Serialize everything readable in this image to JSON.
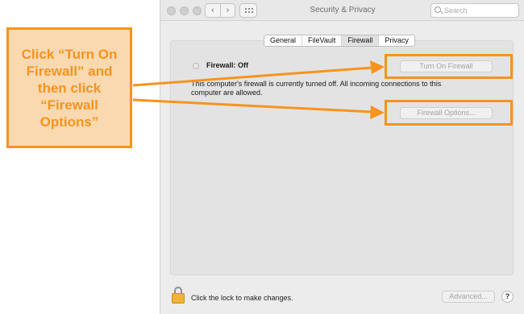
{
  "window": {
    "title": "Security & Privacy",
    "back_icon": "‹",
    "forward_icon": "›"
  },
  "search": {
    "placeholder": "Search"
  },
  "tabs": [
    {
      "label": "General",
      "selected": false
    },
    {
      "label": "FileVault",
      "selected": false
    },
    {
      "label": "Firewall",
      "selected": true
    },
    {
      "label": "Privacy",
      "selected": false
    }
  ],
  "firewall": {
    "status": "Firewall: Off",
    "description": "This computer's firewall is currently turned off. All incoming connections to this computer are allowed.",
    "turn_on_label": "Turn On Firewall",
    "options_label": "Firewall Options..."
  },
  "footer": {
    "lock_text": "Click the lock to make changes.",
    "advanced_label": "Advanced...",
    "help_label": "?"
  },
  "annotation": {
    "text": "Click “Turn On\nFirewall” and\nthen click\n“Firewall\nOptions”",
    "accent_color": "#f7931e",
    "fill_color": "#fbd9b0"
  }
}
